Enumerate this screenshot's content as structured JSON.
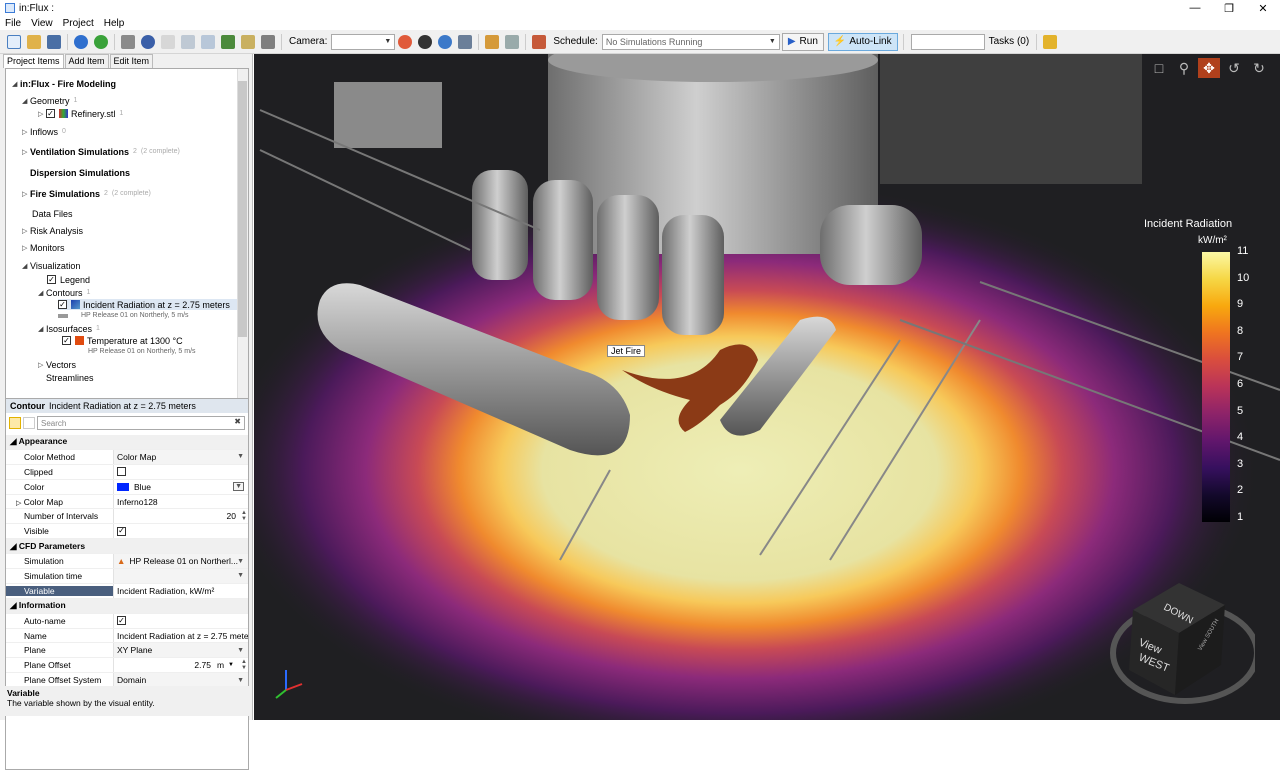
{
  "window": {
    "title": "in:Flux :"
  },
  "menu": [
    "File",
    "View",
    "Project",
    "Help"
  ],
  "toolbar": {
    "camera_label": "Camera:",
    "schedule_label": "Schedule:",
    "schedule_value": "No Simulations Running",
    "run_label": "Run",
    "autolink_label": "Auto-Link",
    "tasks_label": "Tasks (0)"
  },
  "tabs": [
    "Project Items",
    "Add Item",
    "Edit Item"
  ],
  "tree": {
    "root": "in:Flux - Fire Modeling",
    "geometry": {
      "label": "Geometry",
      "count": "1",
      "file": "Refinery.stl",
      "file_count": "1"
    },
    "inflows": {
      "label": "Inflows",
      "count": "0"
    },
    "ventilation": {
      "label": "Ventilation Simulations",
      "count": "2",
      "status": "(2 complete)"
    },
    "dispersion": {
      "label": "Dispersion Simulations"
    },
    "fire": {
      "label": "Fire Simulations",
      "count": "2",
      "status": "(2 complete)"
    },
    "datafiles": {
      "label": "Data Files"
    },
    "risk": {
      "label": "Risk Analysis"
    },
    "monitors": {
      "label": "Monitors"
    },
    "visualization": {
      "label": "Visualization"
    },
    "legend": {
      "label": "Legend"
    },
    "contours": {
      "label": "Contours",
      "count": "1"
    },
    "contour_item": {
      "label": "Incident Radiation at z = 2.75 meters",
      "sub": "HP Release 01 on Northerly, 5 m/s"
    },
    "isosurfaces": {
      "label": "Isosurfaces",
      "count": "1"
    },
    "iso_item": {
      "label": "Temperature at 1300 °C",
      "sub": "HP Release 01 on Northerly, 5 m/s"
    },
    "vectors": {
      "label": "Vectors"
    },
    "streamlines": {
      "label": "Streamlines"
    }
  },
  "props": {
    "head_kind": "Contour",
    "head_name": "Incident Radiation at z = 2.75 meters",
    "search_placeholder": "Search",
    "appearance": "Appearance",
    "color_method": {
      "name": "Color Method",
      "value": "Color Map"
    },
    "clipped": {
      "name": "Clipped"
    },
    "color": {
      "name": "Color",
      "value": "Blue",
      "swatch": "#0026ff"
    },
    "color_map": {
      "name": "Color Map",
      "value": "Inferno128"
    },
    "intervals": {
      "name": "Number of Intervals",
      "value": "20"
    },
    "visible": {
      "name": "Visible"
    },
    "cfd": "CFD Parameters",
    "simulation": {
      "name": "Simulation",
      "value": "HP Release 01 on Northerl..."
    },
    "sim_time": {
      "name": "Simulation time",
      "value": ""
    },
    "variable": {
      "name": "Variable",
      "value": "Incident Radiation, kW/m²"
    },
    "information": "Information",
    "autoname": {
      "name": "Auto-name"
    },
    "name": {
      "name": "Name",
      "value": "Incident Radiation at z = 2.75 meters"
    },
    "plane": {
      "name": "Plane",
      "value": "XY Plane"
    },
    "plane_offset": {
      "name": "Plane Offset",
      "value": "2.75",
      "unit": "m"
    },
    "offset_system": {
      "name": "Plane Offset System",
      "value": "Domain"
    }
  },
  "description": {
    "title": "Variable",
    "text": "The variable shown by the visual entity."
  },
  "viewport": {
    "jet_label": "Jet Fire",
    "cube_top": "DOWN",
    "cube_face": "View",
    "cube_face2": "WEST",
    "cube_side": "View SOUTH"
  },
  "legend": {
    "title": "Incident Radiation",
    "unit": "kW/m²",
    "ticks": [
      "11",
      "10",
      "9",
      "8",
      "7",
      "6",
      "5",
      "4",
      "3",
      "2",
      "1"
    ],
    "colors": [
      "#fbf8a4",
      "#f6d745",
      "#f8a80e",
      "#ef7420",
      "#d94d3e",
      "#b93359",
      "#8d2369",
      "#61166c",
      "#36105e",
      "#13092b",
      "#000004"
    ]
  }
}
